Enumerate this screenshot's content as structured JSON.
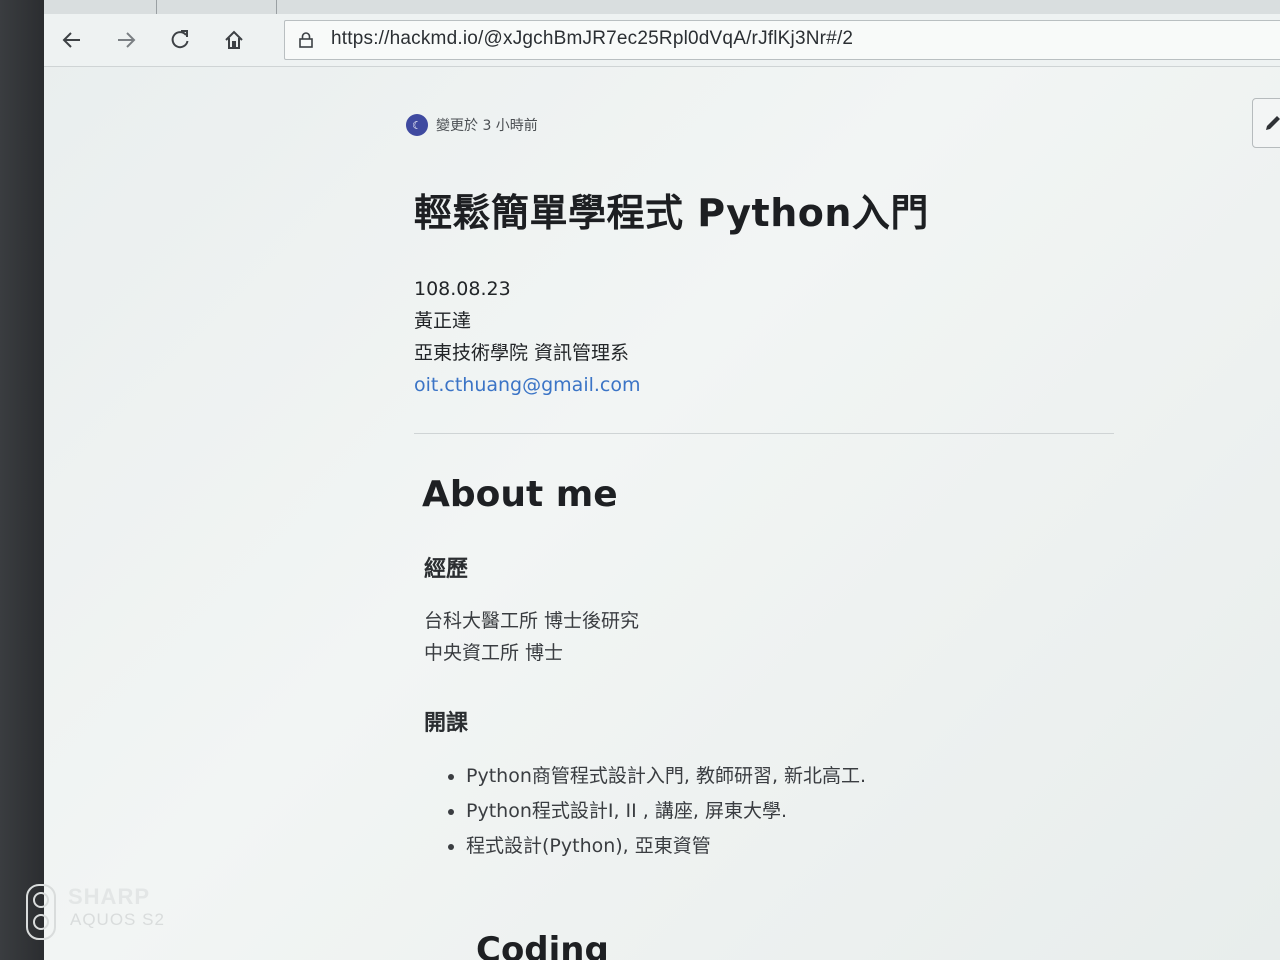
{
  "browser": {
    "url": "https://hackmd.io/@xJgchBmJR7ec25Rpl0dVqA/rJflKj3Nr#/2"
  },
  "doc": {
    "updated": "變更於 3 小時前",
    "title": "輕鬆簡單學程式 Python入門",
    "date": "108.08.23",
    "author": "黃正達",
    "affiliation": "亞東技術學院 資訊管理系",
    "email": "oit.cthuang@gmail.com"
  },
  "about": {
    "heading": "About me",
    "experience_heading": "經歷",
    "experience": [
      "台科大醫工所 博士後研究",
      "中央資工所 博士"
    ],
    "courses_heading": "開課",
    "courses": [
      "Python商管程式設計入門, 教師研習, 新北高工.",
      "Python程式設計I, II , 講座, 屏東大學.",
      "程式設計(Python), 亞東資管"
    ]
  },
  "next_section": "Coding",
  "watermark": {
    "brand": "SHARP",
    "model": "AQUOS S2"
  },
  "icons": {
    "back": "back-arrow-icon",
    "forward": "forward-arrow-icon",
    "refresh": "refresh-icon",
    "home": "home-icon",
    "lock": "lock-icon",
    "edit": "pencil-icon",
    "avatar": "avatar-icon",
    "camera": "camera-icon"
  },
  "colors": {
    "link": "#3b74c6",
    "avatar": "#3f4aa0"
  }
}
